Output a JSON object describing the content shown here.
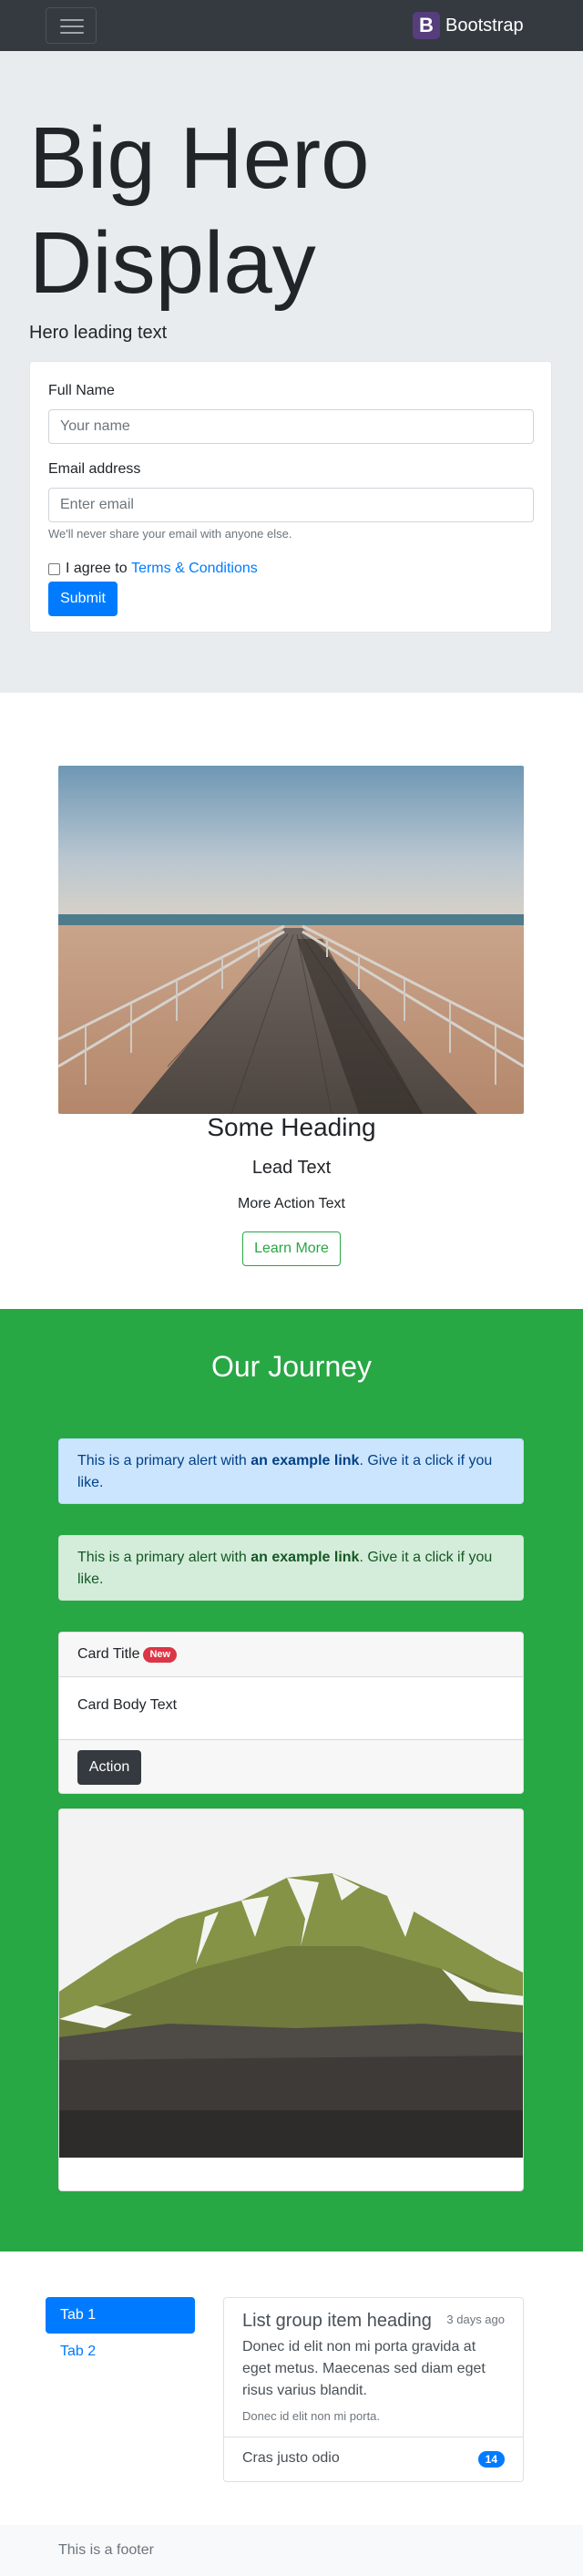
{
  "navbar": {
    "toggler_icon": "hamburger-icon",
    "brand_logo_letter": "B",
    "brand_text": "Bootstrap"
  },
  "hero": {
    "title": "Big Hero Display",
    "lead": "Hero leading text",
    "form": {
      "name_label": "Full Name",
      "name_placeholder": "Your name",
      "email_label": "Email address",
      "email_placeholder": "Enter email",
      "email_help": "We'll never share your email with anyone else.",
      "agree_prefix": "I agree to",
      "agree_link": "Terms & Conditions",
      "submit_label": "Submit"
    }
  },
  "feature": {
    "heading": "Some Heading",
    "lead": "Lead Text",
    "action_text": "More Action Text",
    "button_label": "Learn More"
  },
  "journey": {
    "title": "Our Journey",
    "alert_primary": {
      "prefix": "This is a primary alert with ",
      "link": "an example link",
      "suffix": ". Give it a click if you like."
    },
    "alert_success": {
      "prefix": "This is a primary alert with ",
      "link": "an example link",
      "suffix": ". Give it a click if you like."
    },
    "card": {
      "title": "Card Title",
      "badge": "New",
      "body": "Card Body Text",
      "action_label": "Action"
    }
  },
  "tabs": {
    "items": [
      {
        "label": "Tab 1",
        "active": true
      },
      {
        "label": "Tab 2",
        "active": false
      }
    ]
  },
  "list_group": {
    "heading": "List group item heading",
    "time": "3 days ago",
    "text": "Donec id elit non mi porta gravida at eget metus. Maecenas sed diam eget risus varius blandit.",
    "small": "Donec id elit non mi porta.",
    "item2_label": "Cras justo odio",
    "item2_badge": "14"
  },
  "footer": {
    "text": "This is a footer"
  },
  "colors": {
    "navbar": "#343a40",
    "hero_bg": "#e9ecef",
    "primary": "#007bff",
    "success": "#28a745",
    "danger": "#dc3545",
    "dark": "#343a40"
  }
}
